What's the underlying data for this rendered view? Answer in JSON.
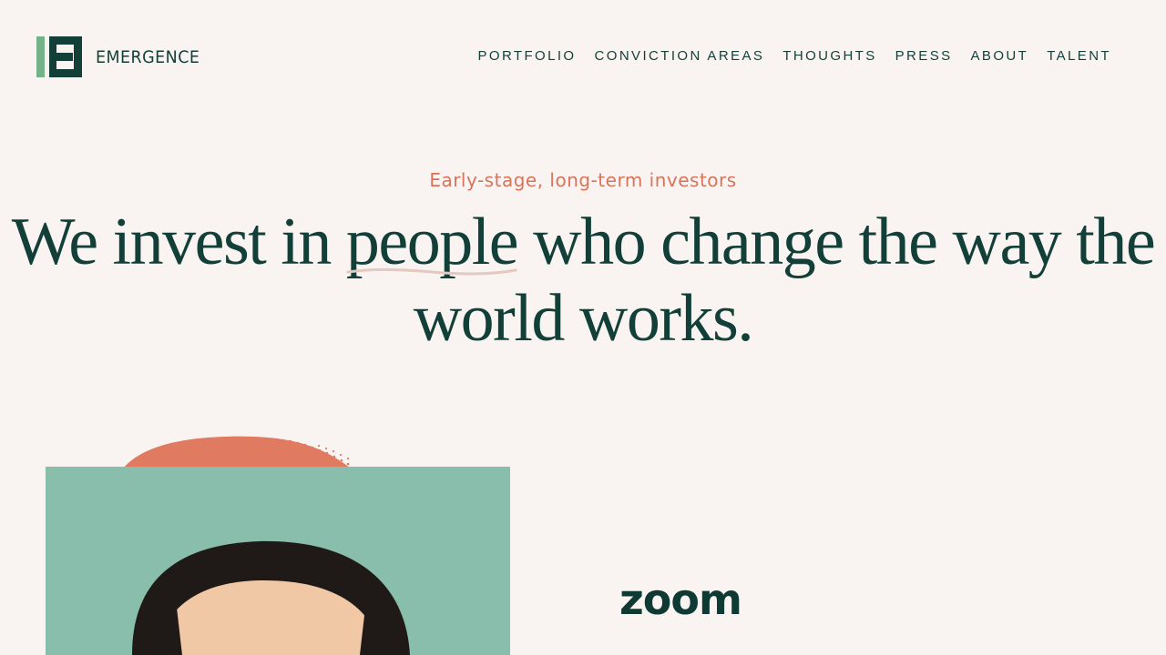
{
  "brand": {
    "name": "EMERGENCE",
    "mark_color_light": "#74b38a",
    "mark_color_dark": "#123f38"
  },
  "nav": [
    {
      "label": "PORTFOLIO"
    },
    {
      "label": "CONVICTION AREAS"
    },
    {
      "label": "THOUGHTS"
    },
    {
      "label": "PRESS"
    },
    {
      "label": "ABOUT"
    },
    {
      "label": "TALENT"
    }
  ],
  "hero": {
    "eyebrow": "Early-stage, long-term investors",
    "headline_before": "We invest in ",
    "headline_highlight": "people",
    "headline_after": " who change the way the world works."
  },
  "feature": {
    "company_logo_text": "zoom",
    "accent_color": "#e07b62",
    "photo_bg_color": "#89bdac"
  }
}
